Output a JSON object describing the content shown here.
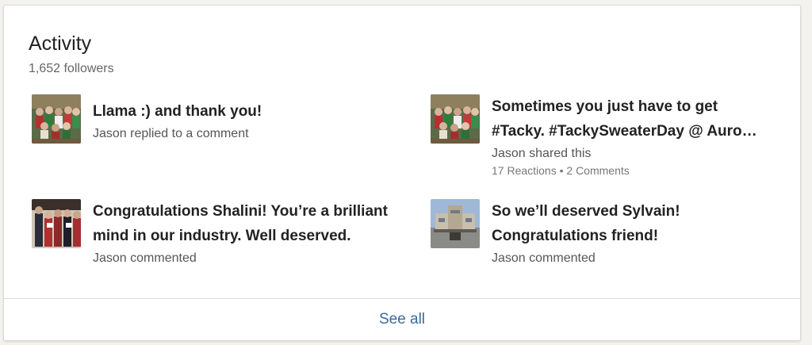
{
  "activity": {
    "title": "Activity",
    "followers": "1,652 followers",
    "see_all": "See all",
    "items": [
      {
        "headline_line1": "Llama :) and thank you!",
        "headline_line2": "",
        "subtitle": "Jason replied to a comment",
        "social": "",
        "thumb_icon": "group-photo-icon"
      },
      {
        "headline_line1": "Sometimes you just have to get",
        "headline_line2": "#Tacky. #TackySweaterDay @ Auro…",
        "subtitle": "Jason shared this",
        "social": "17 Reactions • 2 Comments",
        "thumb_icon": "group-photo-icon"
      },
      {
        "headline_line1": "Congratulations Shalini! You’re a brilliant",
        "headline_line2": "mind in our industry. Well deserved.",
        "subtitle": "Jason commented",
        "social": "",
        "thumb_icon": "award-photo-icon"
      },
      {
        "headline_line1": "So we’ll deserved Sylvain!",
        "headline_line2": "Congratulations friend!",
        "subtitle": "Jason commented",
        "social": "",
        "thumb_icon": "building-photo-icon"
      }
    ]
  },
  "colors": {
    "link": "#3a6a9c",
    "card_border": "#d9d9d9"
  }
}
